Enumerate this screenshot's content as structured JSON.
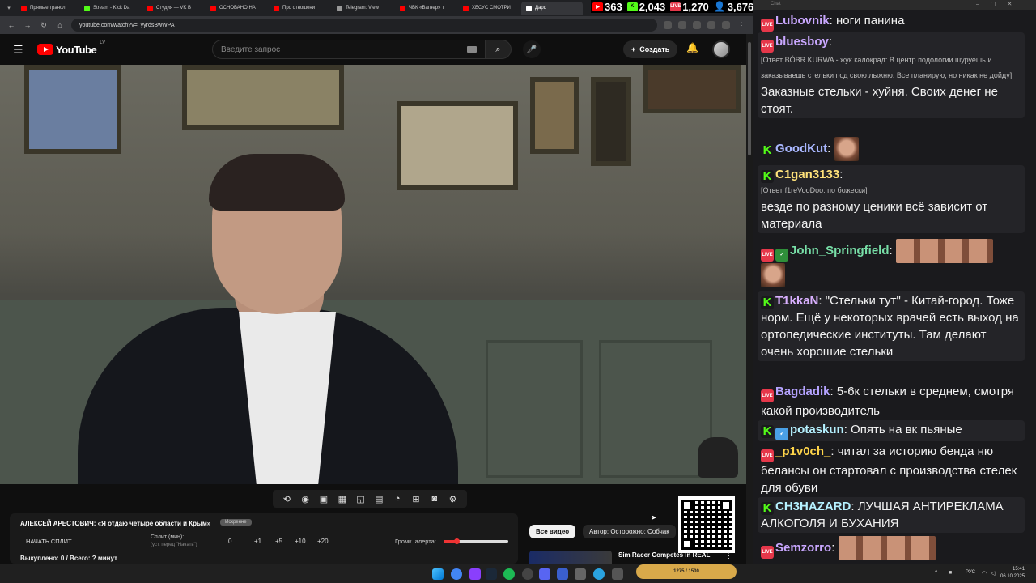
{
  "browser": {
    "tabs": [
      {
        "label": "Прямые трансл",
        "color": "#ff0000"
      },
      {
        "label": "Stream - Kick Da",
        "color": "#53fc18"
      },
      {
        "label": "Студия — VK В",
        "color": "#ff0000"
      },
      {
        "label": "ОСНОВАНО НА",
        "color": "#ff0000"
      },
      {
        "label": "Про отношени",
        "color": "#ff0000"
      },
      {
        "label": "Telegram: View",
        "color": "#999999"
      },
      {
        "label": "ЧВК «Вагнер» т",
        "color": "#ff0000"
      },
      {
        "label": "ХЕСУС СМОТРИ",
        "color": "#ff0000"
      },
      {
        "label": "Дарα",
        "color": "#ffffff"
      }
    ],
    "url": "youtube.com/watch?v=_yyrdsBwWPA"
  },
  "stream_stats": {
    "youtube": "363",
    "kick": "2,043",
    "vk": "1,270",
    "total": "3,676"
  },
  "youtube": {
    "logo": "YouTube",
    "logo_region": "LV",
    "search_placeholder": "Введите запрос",
    "create_label": "Создать"
  },
  "split": {
    "title": "АЛЕКСЕЙ АРЕСТОВИЧ: «Я отдаю четыре области и Крым»",
    "badge": "Искренне",
    "start_label": "НАЧАТЬ СПЛИТ",
    "minutes_label": "Сплит (мин):",
    "minutes_hint": "(уст. перед \"Начать\")",
    "value": "0",
    "increments": [
      "+1",
      "+5",
      "+10",
      "+20"
    ],
    "alert_label": "Громк. алерта:",
    "alert_level": 0.2,
    "footer": "Выкуплено: 0 / Всего: ? минут"
  },
  "chips": {
    "all": "Все видео",
    "author": "Автор: Осторожно: Собчак"
  },
  "recommendation": {
    "title": "Sim Racer Competes In REAL"
  },
  "chat": {
    "header": "Chat",
    "messages": [
      {
        "platform": "live",
        "user": "Lubovnik",
        "color": "#c9a7ff",
        "text": "ноги панина"
      },
      {
        "platform": "live",
        "user": "bluesboy",
        "color": "#c9a7ff",
        "reply": "[Ответ BÓBR KURWA - жук калокрад: В центр подологии шуруешь и заказываешь стельки под свою лыжню. Все планирую, но никак не дойду]",
        "text": "Заказные стельки - хуйня. Своих денег не стоят."
      },
      {
        "platform": "kick",
        "user": "GoodKut",
        "color": "#a9b7ff",
        "text": ""
      },
      {
        "platform": "kick",
        "user": "C1gan3133",
        "color": "#ffe27a",
        "reply": "[Ответ f1reVooDoo: по божески]",
        "text": "везде по разному ценики всё зависит от материала"
      },
      {
        "platform": "live",
        "user": "John_Springfield",
        "color": "#78e0a8",
        "text": ""
      },
      {
        "platform": "kick",
        "user": "T1kkaN",
        "color": "#d9b0ff",
        "text": "\"Стельки тут\" - Китай-город. Тоже норм. Ещё у некоторых врачей есть выход на ортопедические институты. Там делают очень хорошие стельки"
      },
      {
        "platform": "live",
        "user": "Bagdadik",
        "color": "#b5a3ff",
        "text": "5-6к стельки в среднем, смотря какой производитель"
      },
      {
        "platform": "kick",
        "user": "potaskun",
        "color": "#b5f1ff",
        "text": "Опять на вк пьяные"
      },
      {
        "platform": "live",
        "user": "_p1v0ch_",
        "color": "#ffd54a",
        "text": "читал за историю бенда ню белансы он стартовал с производства стелек для обуви"
      },
      {
        "platform": "kick",
        "user": "CH3HAZARD",
        "color": "#b5f1ff",
        "text": "ЛУЧШАЯ АНТИРЕКЛАМА АЛКОГОЛЯ И БУХАНИЯ"
      },
      {
        "platform": "live",
        "user": "Semzorro",
        "color": "#c9a7ff",
        "text": ""
      }
    ]
  },
  "taskbar": {
    "widget": "1275 / 1500",
    "lang": "РУС",
    "time": "15:41",
    "date": "06.10.2025"
  }
}
